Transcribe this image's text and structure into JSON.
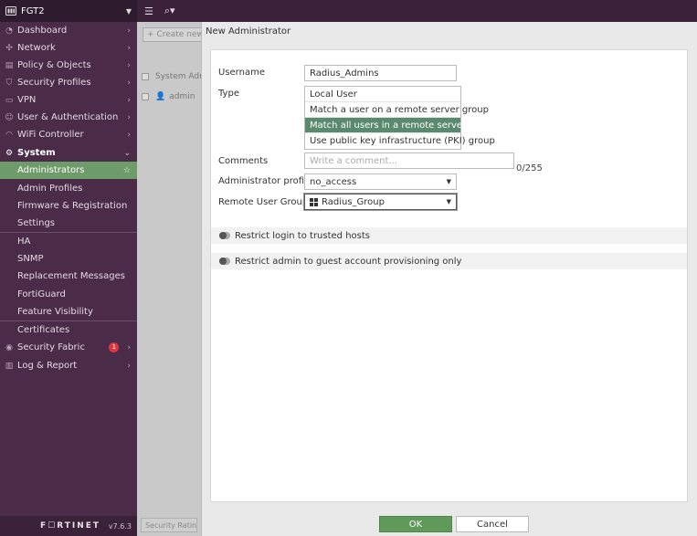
{
  "sidebar": {
    "device_name": "FGT2",
    "items": [
      {
        "label": "Dashboard"
      },
      {
        "label": "Network"
      },
      {
        "label": "Policy & Objects"
      },
      {
        "label": "Security Profiles"
      },
      {
        "label": "VPN"
      },
      {
        "label": "User & Authentication"
      },
      {
        "label": "WiFi Controller"
      },
      {
        "label": "System"
      },
      {
        "label": "Administrators"
      },
      {
        "label": "Admin Profiles"
      },
      {
        "label": "Firmware & Registration"
      },
      {
        "label": "Settings"
      },
      {
        "label": "HA"
      },
      {
        "label": "SNMP"
      },
      {
        "label": "Replacement Messages"
      },
      {
        "label": "FortiGuard"
      },
      {
        "label": "Feature Visibility"
      },
      {
        "label": "Certificates"
      },
      {
        "label": "Security Fabric",
        "badge": "1"
      },
      {
        "label": "Log & Report"
      }
    ],
    "brand": "F☐RTINET",
    "version": "v7.6.3"
  },
  "background": {
    "create_new": "Create new",
    "table_header": "System Admin",
    "row_user": "admin",
    "bottom_button": "Security Rating"
  },
  "panel": {
    "title": "New Administrator",
    "username": {
      "label": "Username",
      "value": "Radius_Admins"
    },
    "type": {
      "label": "Type",
      "options": [
        "Local User",
        "Match a user on a remote server group",
        "Match all users in a remote server group",
        "Use public key infrastructure (PKI) group"
      ],
      "selected": "Match all users in a remote server group"
    },
    "comments": {
      "label": "Comments",
      "placeholder": "Write a comment...",
      "counter": "0/255"
    },
    "admin_profile": {
      "label": "Administrator profile",
      "value": "no_access"
    },
    "remote_group": {
      "label": "Remote User Group",
      "value": "Radius_Group"
    },
    "toggles": {
      "trusted_hosts": "Restrict login to trusted hosts",
      "guest_only": "Restrict admin to guest account provisioning only"
    },
    "ok_label": "OK",
    "cancel_label": "Cancel"
  },
  "colors": {
    "sidebar_bg": "#4a2c48",
    "active_item": "#6d9b6a",
    "selected_option": "#5a8a6e",
    "ok_button": "#5f9a5a",
    "badge": "#d9363e"
  }
}
